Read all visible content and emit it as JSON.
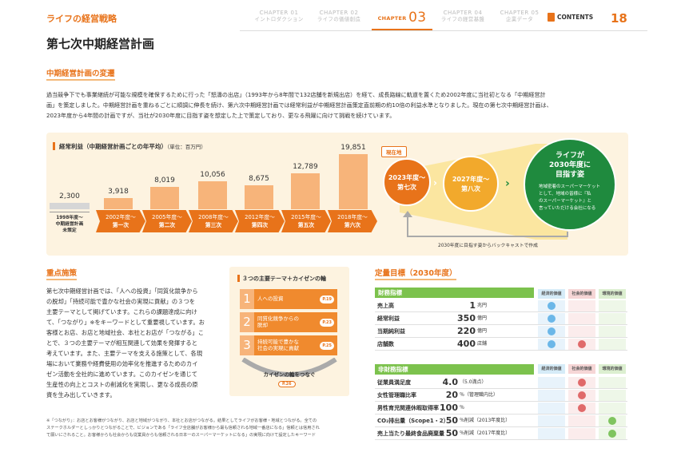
{
  "header": {
    "brand": "ライフの経営戦略",
    "tabs": [
      {
        "ch": "CHAPTER 01",
        "name": "イントロダクション"
      },
      {
        "ch": "CHAPTER 02",
        "name": "ライフの価値創造"
      },
      {
        "ch": "CHAPTER",
        "num": "03",
        "name": ""
      },
      {
        "ch": "CHAPTER 04",
        "name": "ライフの経営基盤"
      },
      {
        "ch": "CHAPTER 05",
        "name": "企業データ"
      }
    ],
    "contents": "CONTENTS",
    "page": "18"
  },
  "title": "第七次中期経営計画",
  "transition": {
    "heading": "中期経営計画の変遷",
    "lines": [
      "過当競争下でも事業継続が可能な規模を確保するために行った「怒濤の出店」（1993年から8年間で132店舗を新規出店）を経て、成長路線に軌道を置くため2002年度に当社初となる「中期経営計",
      "画」を策定しました。中期経営計画を重ねるごとに順調に伸長を続け、第六次中期経営計画では経常利益が中期経営計画策定直前期の約10倍の利益水準となりました。現在の第七次中期経営計画は、",
      "2023年度から4年間の計画ですが、当社が2030年度に目指す姿を想定した上で策定しており、更なる飛躍に向けて挑戦を続けています。"
    ]
  },
  "chart_data": {
    "type": "bar",
    "title": "経常利益（中期経営計画ごとの年平均）",
    "unit": "（単位：百万円）",
    "categories": [
      "1998年度～中期経営計画未策定",
      "第一次",
      "第二次",
      "第三次",
      "第四次",
      "第五次",
      "第六次"
    ],
    "values": [
      2300,
      3918,
      8019,
      10056,
      8675,
      12789,
      19851
    ],
    "value_labels": [
      "2,300",
      "3,918",
      "8,019",
      "10,056",
      "8,675",
      "12,789",
      "19,851"
    ],
    "ylim": [
      0,
      20000
    ]
  },
  "chart_extra": {
    "base_label_lines": [
      "1998年度～",
      "中期経営計画",
      "未策定"
    ],
    "arrows": [
      {
        "year": "2002年度～",
        "name": "第一次"
      },
      {
        "year": "2005年度～",
        "name": "第二次"
      },
      {
        "year": "2008年度～",
        "name": "第三次"
      },
      {
        "year": "2012年度～",
        "name": "第四次"
      },
      {
        "year": "2015年度～",
        "name": "第五次"
      },
      {
        "year": "2018年度～",
        "name": "第六次"
      }
    ],
    "now_badge": "現在地",
    "c1": {
      "l1": "2023年度～",
      "l2": "第七次"
    },
    "c2": {
      "l1": "2027年度～",
      "l2": "第八次"
    },
    "c3": {
      "l1": "ライフが",
      "l2": "2030年度に",
      "l3": "目指す姿",
      "d1": "地域密着のスーパーマーケット",
      "d2": "として、地域の皆様に『私",
      "d3": "のスーパーマーケット』と",
      "d4": "言っていただける会社になる"
    },
    "backcast": "2030年度に目指す姿からバックキャストで作成"
  },
  "focus": {
    "heading": "重点施策",
    "lines": [
      "第七次中期経営計画では、「人への投資」「同質化競争から",
      "の脱却」「持続可能で豊かな社会の実現に貢献」の３つを",
      "主要テーマとして掲げています。これらの課題達成に向け",
      "て、「つながり」※をキーワードとして重要視しています。お",
      "客様とお店、お店と地域社会、本社とお店が「つながる」こ",
      "とで、３つの主要テーマが相互関連して効果を発揮すると",
      "考えています。また、主要テーマを支える施策として、各現",
      "場において業務や経費使用の効率化を推進するためのカイ",
      "ゼン活動を全社的に進めています。このカイゼンを通じて",
      "生産性の向上とコストの削減化を実現し、更なる成長の原",
      "資を生み出していきます。"
    ],
    "note1": "※「つながり」：お店とお客様がつながり、お店と地域がつながり、本社とお店がつながる。結果としてライフがお客様・地域とつながる。全ての",
    "note2": "ステークホルダーとしっかりとつながることで、ビジョンである「ライフ全店舗がお客様から最も信頼される地域一番店になる」信頼とは信用され",
    "note3": "て願いにされること。お客様からも社会からも従業員からも信頼される日本一のスーパーマーケットになる」の実現に向けて設定したキーワード"
  },
  "themes": {
    "heading": "３つの主要テーマ＋カイゼンの輪",
    "items": [
      {
        "num": "1",
        "l1": "人への投資",
        "l2": "",
        "ref": "P.19"
      },
      {
        "num": "2",
        "l1": "同質化競争からの",
        "l2": "脱却",
        "ref": "P.23"
      },
      {
        "num": "3",
        "l1": "持続可能で豊かな",
        "l2": "社会の実現に貢献",
        "ref": "P.25"
      }
    ],
    "kaizen": "カイゼンの輪をつなぐ",
    "kaizen_ref": "P.26"
  },
  "targets": {
    "heading": "定量目標（2030年度）",
    "cols": [
      "経済的価値",
      "社会的価値",
      "環境的価値"
    ],
    "financial_head": "財務指標",
    "financial": [
      {
        "label": "売上高",
        "value": "1",
        "unit": "兆円",
        "marks": [
          1,
          0,
          0
        ]
      },
      {
        "label": "経常利益",
        "value": "350",
        "unit": "億円",
        "marks": [
          1,
          0,
          0
        ]
      },
      {
        "label": "当期純利益",
        "value": "220",
        "unit": "億円",
        "marks": [
          1,
          0,
          0
        ]
      },
      {
        "label": "店舗数",
        "value": "400",
        "unit": "店舗",
        "marks": [
          1,
          1,
          0
        ]
      }
    ],
    "nonfinancial_head": "非財務指標",
    "nonfinancial": [
      {
        "label": "従業員満足度",
        "value": "4.0",
        "unit": "（5.0満点）",
        "marks": [
          0,
          1,
          0
        ]
      },
      {
        "label": "女性管理職比率",
        "value": "20",
        "unit": "％（管理職内比）",
        "marks": [
          0,
          1,
          0
        ]
      },
      {
        "label": "男性育児関連休暇取得率",
        "value": "100",
        "unit": "％",
        "marks": [
          0,
          1,
          0
        ]
      },
      {
        "label": "CO₂排出量（Scope1・2）",
        "value": "50",
        "unit": "％削減（2013年度比）",
        "marks": [
          0,
          0,
          1
        ]
      },
      {
        "label": "売上当たり最終食品廃棄量",
        "value": "50",
        "unit": "％削減（2017年度比）",
        "marks": [
          0,
          0,
          1
        ]
      }
    ]
  }
}
